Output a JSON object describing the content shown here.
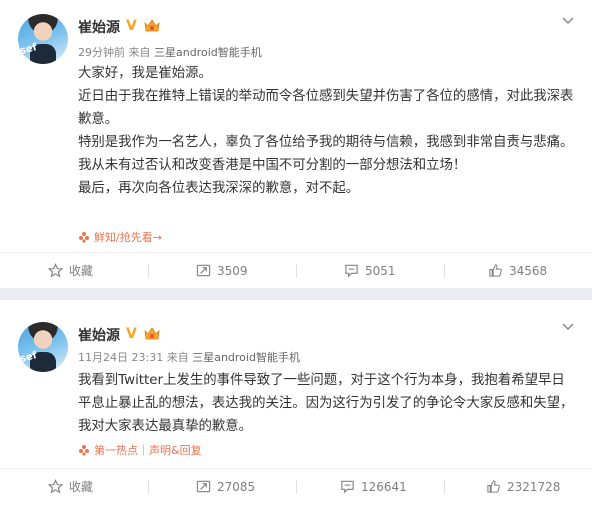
{
  "posts": [
    {
      "username": "崔始源",
      "verified_mark": "V",
      "time": "29分钟前",
      "source_prefix": "来自",
      "device": "三星android智能手机",
      "paragraphs": [
        "大家好，我是崔始源。",
        "近日由于我在推特上错误的举动而令各位感到失望并伤害了各位的感情，对此我深表歉意。",
        "特别是我作为一名艺人，辜负了各位给予我的期待与信赖，我感到非常自责与悲痛。",
        "我从未有过否认和改变香港是中国不可分割的一部分想法和立场！",
        "最后，再次向各位表达我深深的歉意，对不起。"
      ],
      "tag": "鲜知/抢先看→",
      "actions": {
        "favorite": "收藏",
        "repost": "3509",
        "comment": "5051",
        "like": "34568"
      }
    },
    {
      "username": "崔始源",
      "verified_mark": "V",
      "time": "11月24日 23:31",
      "source_prefix": "来自",
      "device": "三星android智能手机",
      "paragraphs": [
        "我看到Twitter上发生的事件导致了一些问题，对于这个行为本身，我抱着希望早日平息止暴止乱的想法，表达我的关注。因为这行为引发了的争论令大家反感和失望，我对大家表达最真挚的歉意。"
      ],
      "tag": "第一热点｜声明&回复",
      "actions": {
        "favorite": "收藏",
        "repost": "27085",
        "comment": "126641",
        "like": "2321728"
      }
    }
  ],
  "colors": {
    "accent": "#eb7350",
    "verified": "#f5a623",
    "divider": "#e9edf2"
  },
  "icons": [
    "avatar",
    "verified-v-icon",
    "crown-badge-icon",
    "chevron-down-icon",
    "star-icon",
    "repost-icon",
    "comment-icon",
    "like-icon",
    "topic-icon"
  ]
}
